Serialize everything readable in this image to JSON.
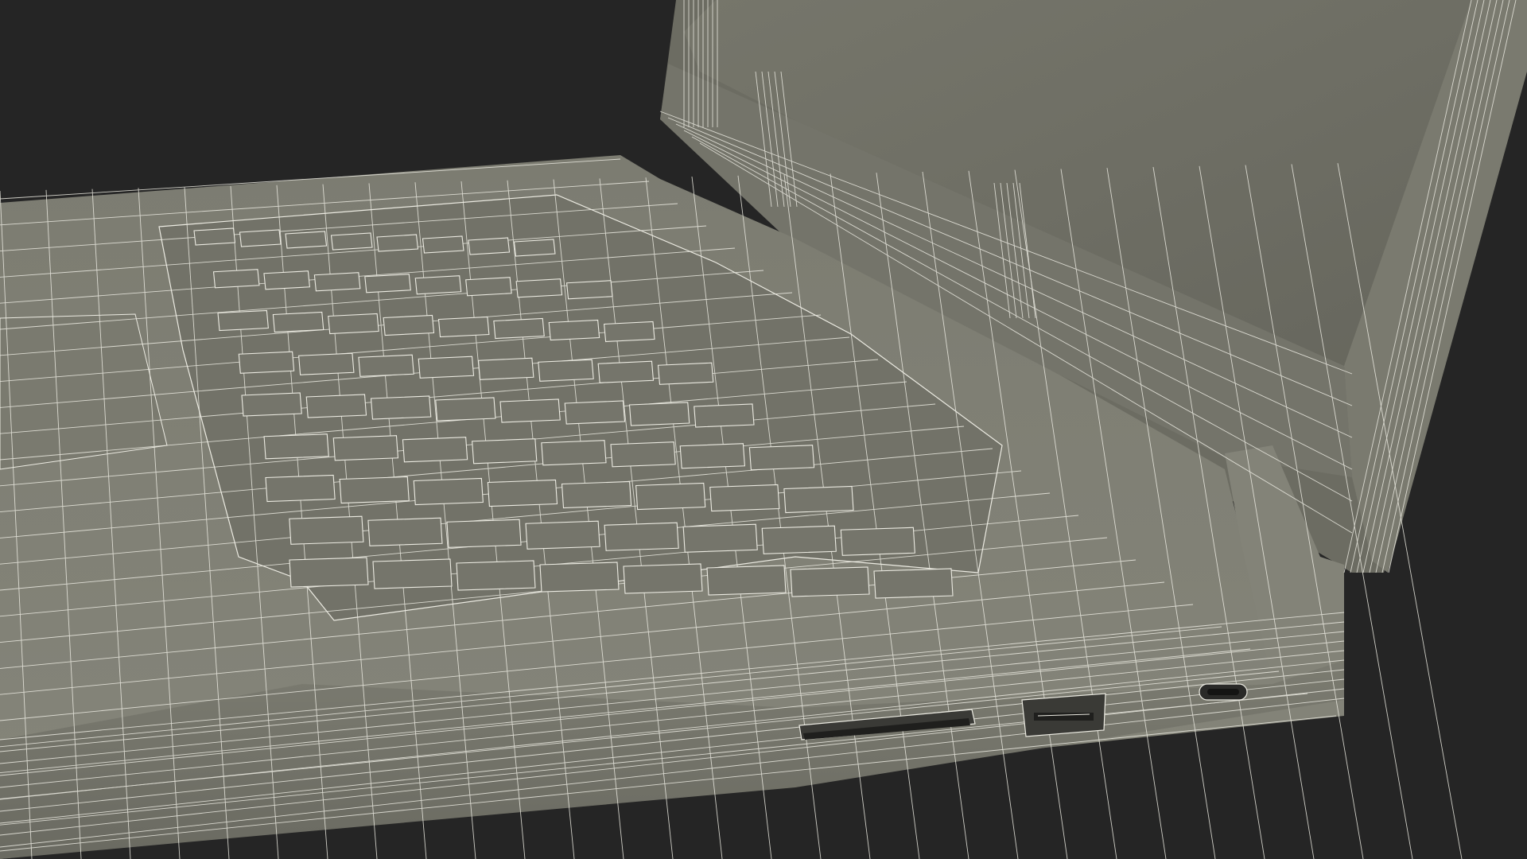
{
  "scene": {
    "subject": "",
    "colors": {
      "background": "#252525",
      "surface": "#7a7a6f",
      "surface_dark": "#5e5e55",
      "surface_light": "#8a8a7e",
      "screen": "#6e6e64",
      "wire": "#ecebe2",
      "port": "#2a2a28"
    }
  }
}
